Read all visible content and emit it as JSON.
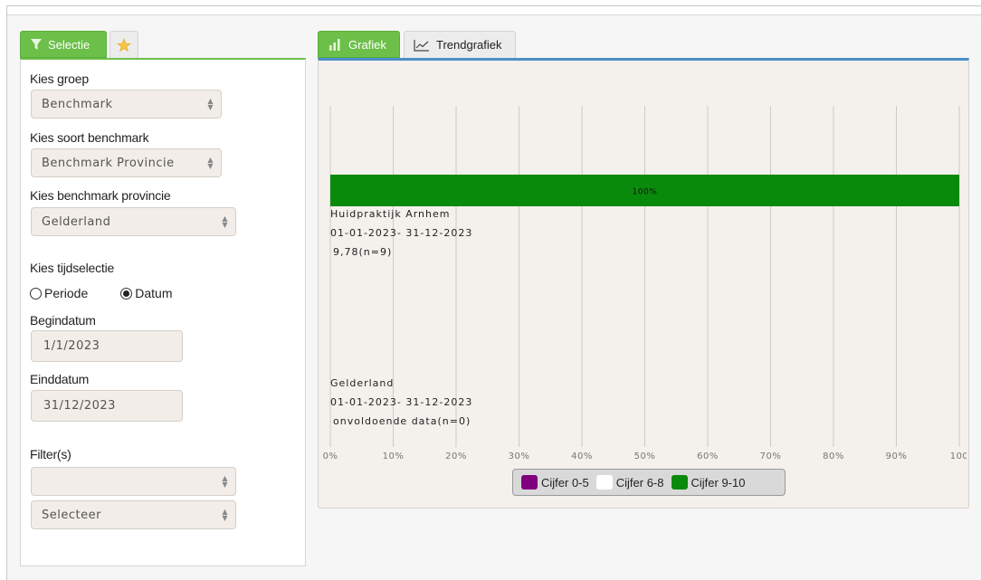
{
  "left_tabs": {
    "selection_label": "Selectie"
  },
  "form": {
    "group_label": "Kies groep",
    "group_value": "Benchmark",
    "benchmark_type_label": "Kies soort benchmark",
    "benchmark_type_value": "Benchmark Provincie",
    "province_label": "Kies benchmark provincie",
    "province_value": "Gelderland",
    "time_label": "Kies tijdselectie",
    "radio_period": "Periode",
    "radio_date": "Datum",
    "time_selected": "Datum",
    "start_label": "Begindatum",
    "start_value": "1/1/2023",
    "end_label": "Einddatum",
    "end_value": "31/12/2023",
    "filters_label": "Filter(s)",
    "filter1_value": "",
    "filter2_value": "Selecteer"
  },
  "right_tabs": {
    "chart_label": "Grafiek",
    "trend_label": "Trendgrafiek"
  },
  "colors": {
    "green_tab": "#6cc04a",
    "bar_green": "#0a8a0a",
    "purple": "#800080",
    "white": "#ffffff",
    "accent_blue": "#4a8fca"
  },
  "chart_data": {
    "type": "bar",
    "orientation": "horizontal",
    "stacked": true,
    "categories": [
      {
        "name": "Huidpraktijk Arnhem",
        "period": "01-01-2023- 31-12-2023",
        "score": "9,78(n=9)"
      },
      {
        "name": "Gelderland",
        "period": "01-01-2023- 31-12-2023",
        "score": "onvoldoende data(n=0)"
      }
    ],
    "series": [
      {
        "name": "Cijfer 0-5",
        "color": "#800080",
        "values": [
          0,
          0
        ]
      },
      {
        "name": "Cijfer 6-8",
        "color": "#ffffff",
        "values": [
          0,
          0
        ]
      },
      {
        "name": "Cijfer 9-10",
        "color": "#0a8a0a",
        "values": [
          100,
          0
        ]
      }
    ],
    "data_labels": [
      "100%",
      ""
    ],
    "xlim": [
      0,
      100
    ],
    "x_ticks": [
      "0%",
      "10%",
      "20%",
      "30%",
      "40%",
      "50%",
      "60%",
      "70%",
      "80%",
      "90%",
      "100"
    ],
    "grid": true,
    "legend_position": "bottom"
  }
}
